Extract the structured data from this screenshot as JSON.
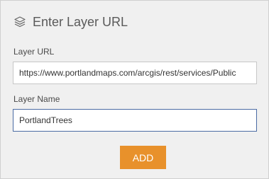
{
  "header": {
    "title": "Enter Layer URL",
    "icon": "layers-icon"
  },
  "form": {
    "url_label": "Layer URL",
    "url_value": "https://www.portlandmaps.com/arcgis/rest/services/Public",
    "name_label": "Layer Name",
    "name_value": "PortlandTrees"
  },
  "actions": {
    "add_label": "ADD"
  },
  "colors": {
    "accent": "#e8912b",
    "focus_border": "#4a6ba3",
    "panel_bg": "#f0f0f0"
  }
}
